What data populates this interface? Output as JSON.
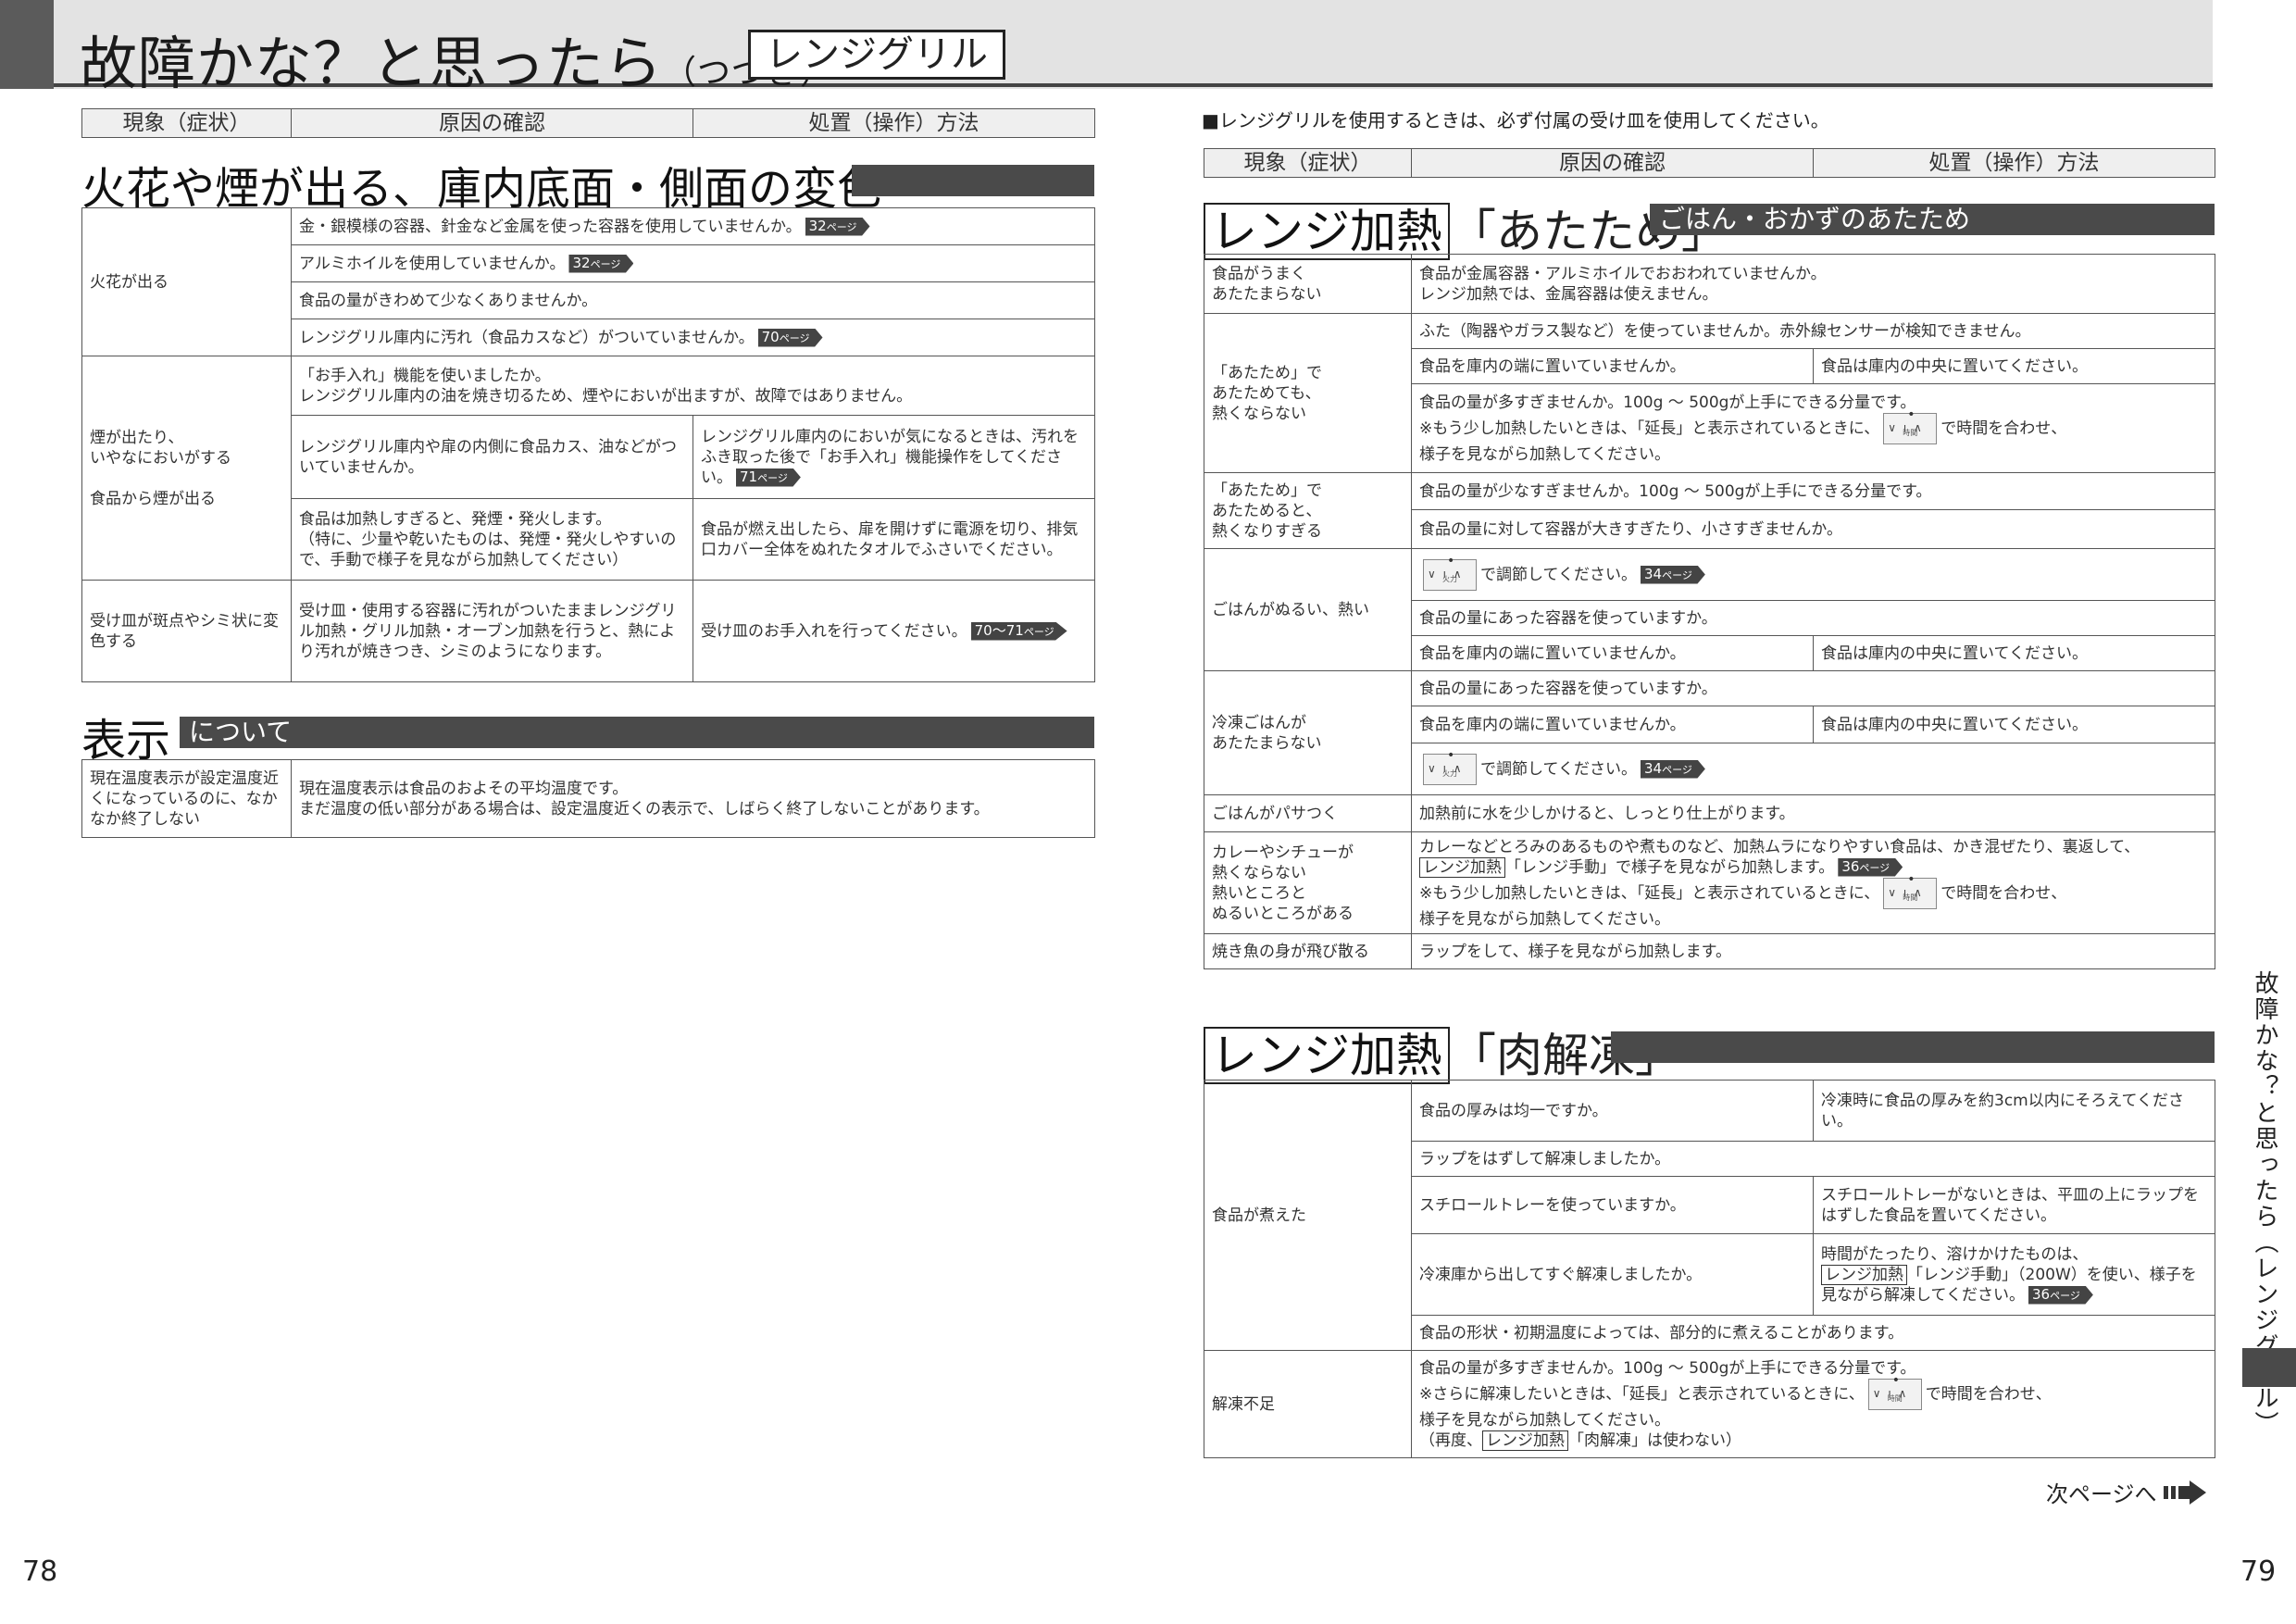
{
  "header": {
    "title": "故障かな？と思ったら",
    "subtitle": "（つづき）",
    "badge": "レンジグリル"
  },
  "table_headers": {
    "symptom": "現象（症状）",
    "cause": "原因の確認",
    "action": "処置（操作）方法"
  },
  "left": {
    "section1": {
      "title": "火花や煙が出る、庫内底面・側面の変色"
    },
    "s1_rows": {
      "spark": "火花が出る",
      "spark_c1": "金・銀模様の容器、針金など金属を使った容器を使用していませんか。",
      "spark_c1_page": "32",
      "spark_c2": "アルミホイルを使用していませんか。",
      "spark_c2_page": "32",
      "spark_c3": "食品の量がきわめて少なくありませんか。",
      "spark_c4": "レンジグリル庫内に汚れ（食品カスなど）がついていませんか。",
      "spark_c4_page": "70",
      "smoke": "煙が出たり、\nいやなにおいがする\n\n食品から煙が出る",
      "smoke_c1": "「お手入れ」機能を使いましたか。\nレンジグリル庫内の油を焼き切るため、煙やにおいが出ますが、故障ではありません。",
      "smoke_c2": "レンジグリル庫内や扉の内側に食品カス、油などがついていませんか。",
      "smoke_a2": "レンジグリル庫内のにおいが気になるときは、汚れをふき取った後で「お手入れ」機能操作をしてください。",
      "smoke_a2_page": "71",
      "smoke_c3": "食品は加熱しすぎると、発煙・発火します。\n（特に、少量や乾いたものは、発煙・発火しやすいので、手動で様子を見ながら加熱してください）",
      "smoke_a3": "食品が燃え出したら、扉を開けずに電源を切り、排気口カバー全体をぬれたタオルでふさいでください。",
      "tray": "受け皿が斑点やシミ状に変色する",
      "tray_c": "受け皿・使用する容器に汚れがついたままレンジグリル加熱・グリル加熱・オーブン加熱を行うと、熱により汚れが焼きつき、シミのようになります。",
      "tray_a": "受け皿のお手入れを行ってください。",
      "tray_a_page": "70〜71"
    },
    "section2": {
      "title": "表示",
      "label": "について"
    },
    "s2_rows": {
      "temp": "現在温度表示が設定温度近くになっているのに、なかなか終了しない",
      "temp_c": "現在温度表示は食品のおよその平均温度です。\nまだ温度の低い部分がある場合は、設定温度近くの表示で、しばらく終了しないことがあります。"
    },
    "page_number": "78"
  },
  "right": {
    "note": "■レンジグリルを使用するときは、必ず付属の受け皿を使用してください。",
    "section1": {
      "boxed": "レンジ加熱",
      "quote": "「あたため」",
      "label": "ごはん・おかずのあたため"
    },
    "r1": {
      "notwarm": "食品がうまく\nあたたまらない",
      "notwarm_c": "食品が金属容器・アルミホイルでおおわれていませんか。\nレンジ加熱では、金属容器は使えません。",
      "atatame": "「あたため」で\nあたためても、\n熱くならない",
      "atatame_c1": "ふた（陶器やガラス製など）を使っていませんか。赤外線センサーが検知できません。",
      "atatame_c2": "食品を庫内の端に置いていませんか。",
      "atatame_a2": "食品は庫内の中央に置いてください。",
      "atatame_c3": "食品の量が多すぎませんか。100g 〜 500gが上手にできる分量です。",
      "atatame_c3b_pre": "※もう少し加熱したいときは、「延長」と表示されているときに、",
      "atatame_c3b_post": "で時間を合わせ、\n様子を見ながら加熱してください。",
      "hot": "「あたため」で\nあたためると、\n熱くなりすぎる",
      "hot_c1": "食品の量が少なすぎませんか。100g 〜 500gが上手にできる分量です。",
      "hot_c2": "食品の量に対して容器が大きすぎたり、小さすぎませんか。",
      "rice": "ごはんがぬるい、熱い",
      "rice_c1_post": "で調節してください。",
      "rice_c1_page": "34",
      "rice_c2": "食品の量にあった容器を使っていますか。",
      "rice_c3": "食品を庫内の端に置いていませんか。",
      "rice_a3": "食品は庫内の中央に置いてください。",
      "frozen": "冷凍ごはんが\nあたたまらない",
      "frozen_c1": "食品の量にあった容器を使っていますか。",
      "frozen_c2": "食品を庫内の端に置いていませんか。",
      "frozen_a2": "食品は庫内の中央に置いてください。",
      "frozen_c3_post": "で調節してください。",
      "frozen_c3_page": "34",
      "dry": "ごはんがパサつく",
      "dry_c": "加熱前に水を少しかけると、しっとり仕上がります。",
      "curry": "カレーやシチューが\n熱くならない\n熱いところと\nぬるいところがある",
      "curry_c1_pre": "カレーなどとろみのあるものや煮ものなど、加熱ムラになりやすい食品は、かき混ぜたり、裏返して、",
      "curry_c1_box": "レンジ加熱",
      "curry_c1_post": "「レンジ手動」で様子を見ながら加熱します。",
      "curry_c1_page": "36",
      "curry_c2_pre": "※もう少し加熱したいときは、「延長」と表示されているときに、",
      "curry_c2_post": "で時間を合わせ、\n様子を見ながら加熱してください。",
      "fish": "焼き魚の身が飛び散る",
      "fish_c": "ラップをして、様子を見ながら加熱します。"
    },
    "section2": {
      "boxed": "レンジ加熱",
      "quote": "「肉解凍」"
    },
    "r2": {
      "boiled": "食品が煮えた",
      "b_c1": "食品の厚みは均一ですか。",
      "b_a1": "冷凍時に食品の厚みを約3cm以内にそろえてください。",
      "b_c2": "ラップをはずして解凍しましたか。",
      "b_c3": "スチロールトレーを使っていますか。",
      "b_a3": "スチロールトレーがないときは、平皿の上にラップをはずした食品を置いてください。",
      "b_c4": "冷凍庫から出してすぐ解凍しましたか。",
      "b_a4_pre": "時間がたったり、溶けかけたものは、",
      "b_a4_box": "レンジ加熱",
      "b_a4_post": "「レンジ手動」（200W）を使い、様子を見ながら解凍してください。",
      "b_a4_page": "36",
      "b_c5": "食品の形状・初期温度によっては、部分的に煮えることがあります。",
      "under": "解凍不足",
      "u_c1": "食品の量が多すぎませんか。100g 〜 500gが上手にできる分量です。",
      "u_c2_pre": "※さらに解凍したいときは、「延長」と表示されているときに、",
      "u_c2_post": "で時間を合わせ、\n様子を見ながら加熱してください。",
      "u_c3_pre": "（再度、",
      "u_c3_box": "レンジ加熱",
      "u_c3_post": "「肉解凍」は使わない）"
    },
    "next": "次ページへ",
    "side_label": "故障かな？と思ったら（レンジグリル）",
    "page_number": "79"
  },
  "ui": {
    "page_suffix": "ページ",
    "dial_fire": "火力",
    "dial_time": "時間"
  }
}
